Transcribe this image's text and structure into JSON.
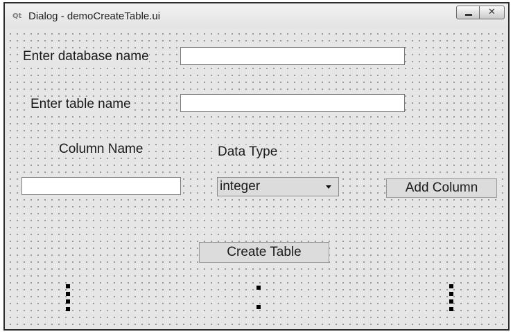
{
  "window": {
    "title": "Dialog - demoCreateTable.ui",
    "app_icon": "Qt",
    "close_glyph": "✕"
  },
  "form": {
    "database_label": "Enter database name",
    "database_value": "",
    "table_label": "Enter table name",
    "table_value": "",
    "column_name_header": "Column Name",
    "data_type_header": "Data Type",
    "column_name_value": "",
    "data_type_selected": "integer",
    "add_column_button": "Add Column",
    "create_table_button": "Create Table"
  },
  "icons": {
    "app": "qt-logo-icon",
    "minimize": "minimize-icon",
    "close": "close-icon",
    "dropdown": "chevron-down-icon",
    "spacer": "vertical-spacer-icon"
  }
}
